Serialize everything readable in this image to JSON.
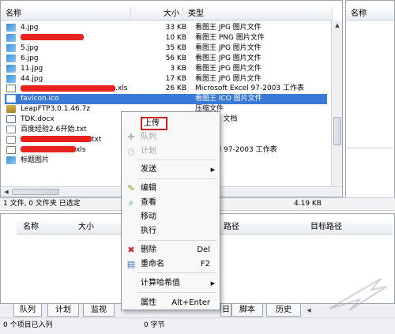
{
  "left_pane": {
    "columns": {
      "name": "名称",
      "size": "大小",
      "type": "类型"
    },
    "files": [
      {
        "name": "4.jpg",
        "redacted": false,
        "size": "33 KB",
        "type": "看图王 JPG 图片文件",
        "icon": "image-file-icon"
      },
      {
        "name": "",
        "redacted": true,
        "size": "10 KB",
        "type": "看图王 PNG 图片文件",
        "icon": "image-file-icon"
      },
      {
        "name": "5.jpg",
        "redacted": false,
        "size": "35 KB",
        "type": "看图王 JPG 图片文件",
        "icon": "image-file-icon"
      },
      {
        "name": "6.jpg",
        "redacted": false,
        "size": "56 KB",
        "type": "看图王 JPG 图片文件",
        "icon": "image-file-icon"
      },
      {
        "name": "11.jpg",
        "redacted": false,
        "size": "3 KB",
        "type": "看图王 JPG 图片文件",
        "icon": "image-file-icon"
      },
      {
        "name": "44.jpg",
        "redacted": false,
        "size": "17 KB",
        "type": "看图王 JPG 图片文件",
        "icon": "image-file-icon"
      },
      {
        "name": ".xls",
        "redacted": true,
        "size": "26 KB",
        "type": "Microsoft Excel 97-2003 工作表",
        "icon": "excel-file-icon"
      },
      {
        "name": "favicon.ico",
        "redacted": false,
        "size": "",
        "type": "看图王 ICO 图片文件",
        "icon": "ico-file-icon",
        "selected": true
      },
      {
        "name": "LeapFTP3.0.1.46.7z",
        "redacted": false,
        "size": "",
        "type": "压缩文件",
        "icon": "archive-file-icon"
      },
      {
        "name": "TDK.docx",
        "redacted": false,
        "size": "",
        "type": "ft Word 文档",
        "icon": "word-file-icon"
      },
      {
        "name": "百度经验2.6开始.txt",
        "redacted": false,
        "size": "",
        "type": "",
        "icon": "text-file-icon"
      },
      {
        "name": "txt",
        "redacted": true,
        "size": "",
        "type": "",
        "icon": "text-file-icon"
      },
      {
        "name": "xls",
        "redacted": true,
        "size": "",
        "type": "ft Excel 97-2003 工作表",
        "icon": "excel-file-icon"
      },
      {
        "name": "标题图片",
        "redacted": false,
        "size": "",
        "type": "",
        "icon": "image-file-icon"
      }
    ]
  },
  "right_pane": {
    "column_name": "名称"
  },
  "status_bar": {
    "left_text": "1 文件, 0 文件夹  已选定",
    "right_text": "4.19 KB"
  },
  "queue_pane": {
    "columns": {
      "name": "名称",
      "size": "大小",
      "path": "路径",
      "target_path": "目标路径"
    }
  },
  "tabs": [
    {
      "label": "队列",
      "active": true
    },
    {
      "label": "计划"
    },
    {
      "label": "监视"
    },
    {
      "label": "日"
    },
    {
      "label": "脚本"
    },
    {
      "label": "历史"
    }
  ],
  "bottom_status": {
    "left_text": "0 个项目已入列",
    "mid_text": "0 字节"
  },
  "context_menu": {
    "items": [
      {
        "label": "上传",
        "icon": "upload-icon",
        "highlight": true
      },
      {
        "label": "队列",
        "icon": "queue-add-icon",
        "disabled": true
      },
      {
        "label": "计划",
        "icon": "schedule-icon",
        "disabled": true
      },
      {
        "label": "发送",
        "submenu": true
      },
      {
        "label": "编辑",
        "icon": "pencil-icon"
      },
      {
        "label": "查看",
        "icon": "magnifier-icon"
      },
      {
        "label": "移动"
      },
      {
        "label": "执行"
      },
      {
        "label": "删除",
        "icon": "delete-icon",
        "shortcut": "Del"
      },
      {
        "label": "重命名",
        "icon": "rename-icon",
        "shortcut": "F2"
      },
      {
        "label": "计算哈希值",
        "submenu": true
      },
      {
        "label": "属性",
        "shortcut": "Alt+Enter"
      }
    ]
  },
  "colors": {
    "selection": "#3b79d6",
    "redaction": "#e8221f",
    "highlight_border": "#c8231d"
  }
}
